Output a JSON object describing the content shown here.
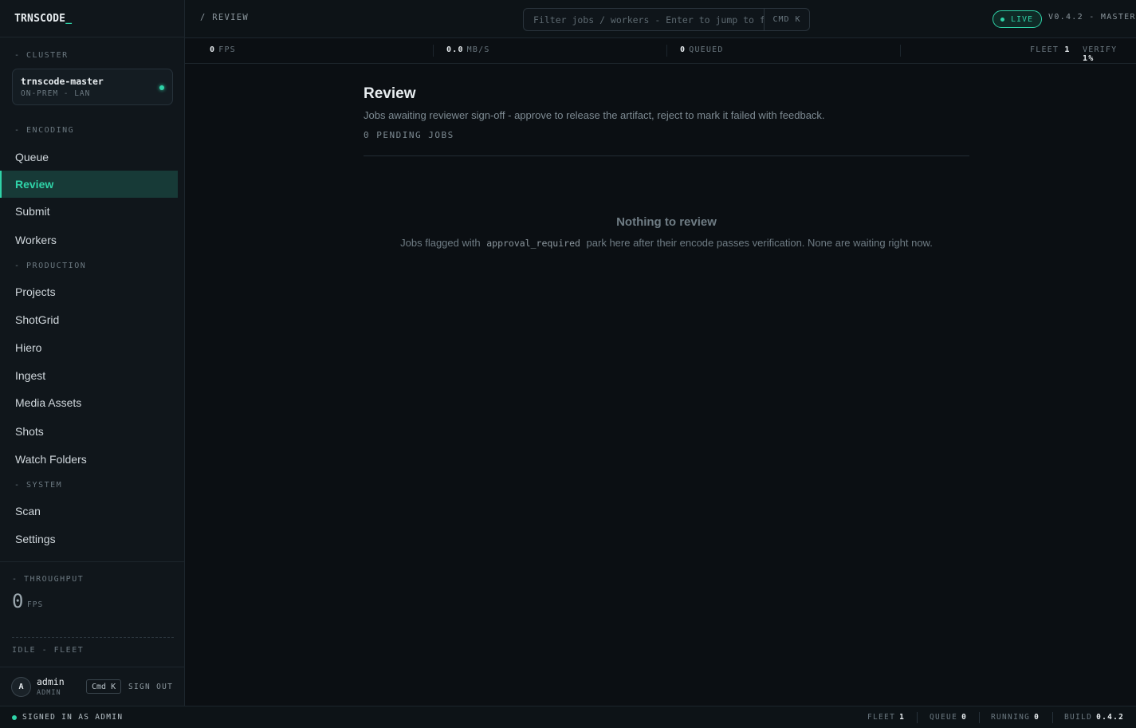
{
  "brand": {
    "name": "TRNSCODE",
    "cursor": "_"
  },
  "sidebar": {
    "cluster_label": "- CLUSTER",
    "cluster": {
      "name": "trnscode-master",
      "sub": "ON-PREM - LAN"
    },
    "sections": {
      "encoding": "- ENCODING",
      "production": "- PRODUCTION",
      "system": "- SYSTEM"
    },
    "items": {
      "queue": "Queue",
      "review": "Review",
      "submit": "Submit",
      "workers": "Workers",
      "projects": "Projects",
      "shotgrid": "ShotGrid",
      "hiero": "Hiero",
      "ingest": "Ingest",
      "media_assets": "Media Assets",
      "shots": "Shots",
      "watch_folders": "Watch Folders",
      "scan": "Scan",
      "settings": "Settings"
    },
    "throughput": {
      "label": "- THROUGHPUT",
      "value": "0",
      "unit": "FPS"
    },
    "fleet_status": "IDLE - FLEET",
    "user": {
      "initial": "A",
      "name": "admin",
      "role": "ADMIN",
      "shortcut": "Cmd K",
      "signout": "SIGN OUT"
    }
  },
  "topbar": {
    "breadcrumb": "/ REVIEW",
    "search_placeholder": "Filter jobs / workers - Enter to jump to first match",
    "search_shortcut": "CMD K",
    "live": "LIVE",
    "version": "V0.4.2 - MASTER"
  },
  "stats": {
    "fps": {
      "value": "0",
      "label": "FPS"
    },
    "mbps": {
      "value": "0.0",
      "label": "MB/S"
    },
    "queued": {
      "value": "0",
      "label": "QUEUED"
    },
    "fleet": {
      "label": "FLEET",
      "value": "1"
    },
    "verify": {
      "label": "VERIFY",
      "value": "1%"
    }
  },
  "main": {
    "title": "Review",
    "description": "Jobs awaiting reviewer sign-off - approve to release the artifact, reject to mark it failed with feedback.",
    "pending": "0 PENDING JOBS",
    "empty_title": "Nothing to review",
    "empty_before": "Jobs flagged with",
    "empty_code": "approval_required",
    "empty_after": "park here after their encode passes verification. None are waiting right now."
  },
  "footer": {
    "signed_in": "SIGNED IN AS ADMIN",
    "fleet": {
      "label": "FLEET",
      "value": "1"
    },
    "queue": {
      "label": "QUEUE",
      "value": "0"
    },
    "running": {
      "label": "RUNNING",
      "value": "0"
    },
    "build": {
      "label": "BUILD",
      "value": "0.4.2"
    }
  },
  "colors": {
    "accent": "#2fd3a8",
    "background": "#0b0f13",
    "sidebar": "#10161b"
  }
}
